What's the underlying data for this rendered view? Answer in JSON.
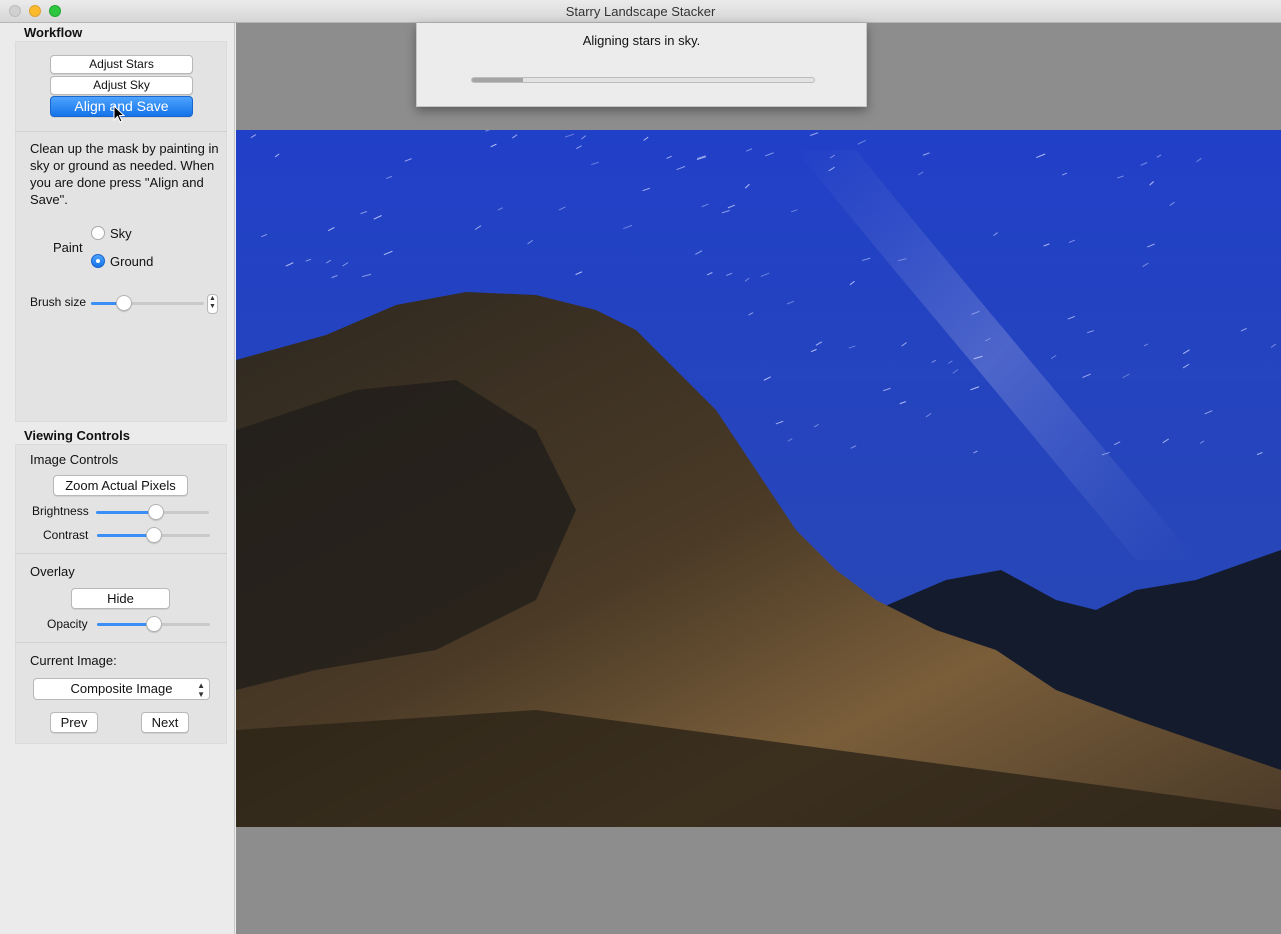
{
  "window": {
    "title": "Starry Landscape Stacker"
  },
  "workflow": {
    "title": "Workflow",
    "buttons": {
      "adjust_stars": "Adjust Stars",
      "adjust_sky": "Adjust Sky",
      "align_save": "Align and Save"
    },
    "instructions": "Clean up the mask by painting in sky or ground as needed. When you are done press \"Align and Save\".",
    "paint": {
      "label": "Paint",
      "options": [
        "Sky",
        "Ground"
      ],
      "selected": "Ground"
    },
    "brush_size": {
      "label": "Brush size",
      "value_fraction": 0.29
    }
  },
  "viewing": {
    "title": "Viewing Controls",
    "image_controls": {
      "label": "Image Controls",
      "zoom_button": "Zoom Actual Pixels",
      "brightness": {
        "label": "Brightness",
        "value_fraction": 0.53
      },
      "contrast": {
        "label": "Contrast",
        "value_fraction": 0.5
      }
    },
    "overlay": {
      "label": "Overlay",
      "hide_button": "Hide",
      "opacity": {
        "label": "Opacity",
        "value_fraction": 0.5
      }
    },
    "current_image": {
      "label": "Current Image:",
      "selected": "Composite Image",
      "prev": "Prev",
      "next": "Next"
    }
  },
  "progress": {
    "message": "Aligning stars in sky.",
    "value_fraction": 0.15
  },
  "colors": {
    "accent": "#1573e8",
    "sky": "#2542c0",
    "canvas": "#8d8d8d"
  }
}
